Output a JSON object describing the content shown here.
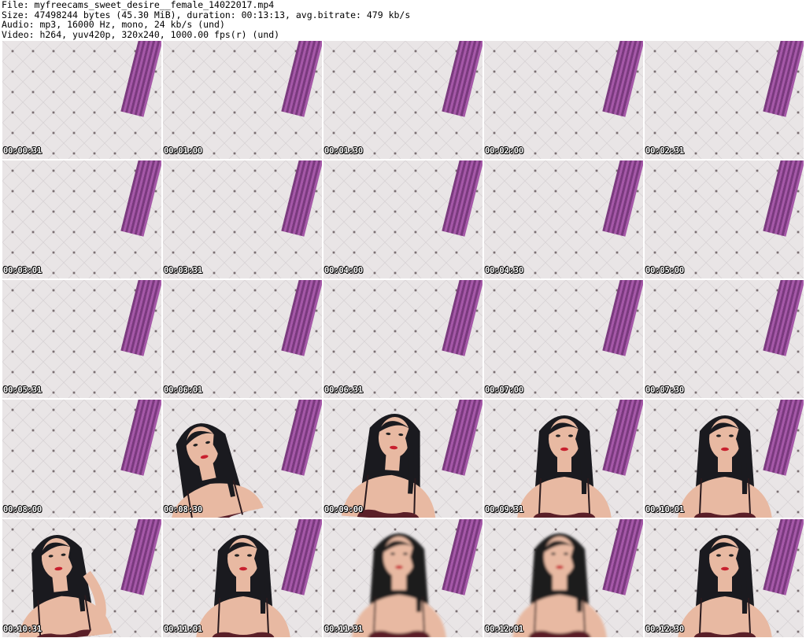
{
  "header": {
    "file_line": "File: myfreecams_sweet_desire__female_14022017.mp4",
    "size_line": "Size: 47498244 bytes (45.30 MiB), duration: 00:13:13, avg.bitrate: 479 kb/s",
    "audio_line": "Audio: mp3, 16000 Hz, mono, 24 kb/s (und)",
    "video_line": "Video: h264, yuv420p, 320x240, 1000.00 fps(r) (und)"
  },
  "colors": {
    "wall": "#e9e5e6",
    "curtain": "#8e4a92",
    "hair": "#1a1a1f",
    "skin": "#e8b9a2",
    "garment": "#5a1f28"
  },
  "thumbnails": [
    {
      "time": "00:00:31",
      "scene": "empty"
    },
    {
      "time": "00:01:00",
      "scene": "empty"
    },
    {
      "time": "00:01:30",
      "scene": "empty"
    },
    {
      "time": "00:02:00",
      "scene": "empty"
    },
    {
      "time": "00:02:31",
      "scene": "empty"
    },
    {
      "time": "00:03:01",
      "scene": "empty"
    },
    {
      "time": "00:03:31",
      "scene": "empty"
    },
    {
      "time": "00:04:00",
      "scene": "empty"
    },
    {
      "time": "00:04:30",
      "scene": "empty"
    },
    {
      "time": "00:05:00",
      "scene": "empty"
    },
    {
      "time": "00:05:31",
      "scene": "empty"
    },
    {
      "time": "00:06:01",
      "scene": "empty"
    },
    {
      "time": "00:06:31",
      "scene": "empty"
    },
    {
      "time": "00:07:00",
      "scene": "empty"
    },
    {
      "time": "00:07:30",
      "scene": "empty"
    },
    {
      "time": "00:08:00",
      "scene": "empty"
    },
    {
      "time": "00:08:30",
      "scene": "person-leaning"
    },
    {
      "time": "00:09:00",
      "scene": "person-looking-down"
    },
    {
      "time": "00:09:31",
      "scene": "person-center"
    },
    {
      "time": "00:10:01",
      "scene": "person-center"
    },
    {
      "time": "00:10:31",
      "scene": "person-arm-raised"
    },
    {
      "time": "00:11:01",
      "scene": "person-center"
    },
    {
      "time": "00:11:31",
      "scene": "person-blurred"
    },
    {
      "time": "00:12:01",
      "scene": "person-blurred"
    },
    {
      "time": "00:12:30",
      "scene": "person-center"
    }
  ]
}
